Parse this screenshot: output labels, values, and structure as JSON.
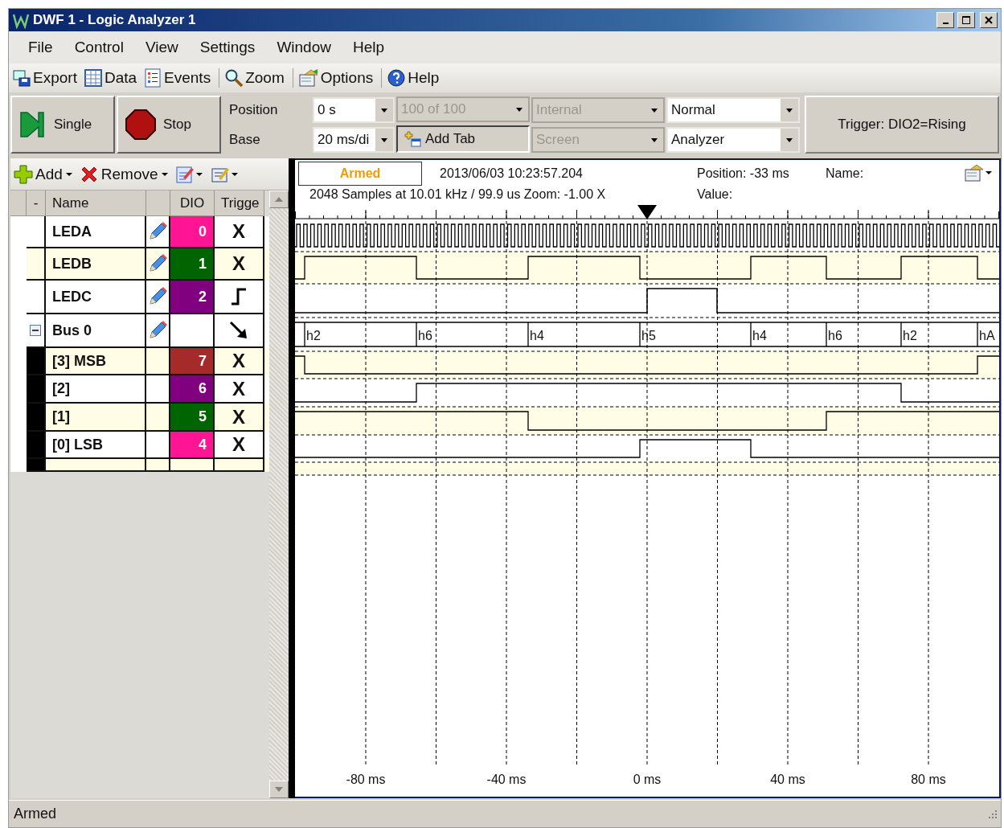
{
  "window": {
    "title": "DWF 1 - Logic Analyzer 1"
  },
  "menu": [
    "File",
    "Control",
    "View",
    "Settings",
    "Window",
    "Help"
  ],
  "toolbar": [
    [
      "Export",
      "Data",
      "Events"
    ],
    [
      "Zoom"
    ],
    [
      "Options"
    ],
    [
      "Help"
    ]
  ],
  "acquisition": {
    "single": "Single",
    "stop": "Stop",
    "position_label": "Position",
    "position_value": "0 s",
    "base_label": "Base",
    "base_value": "20 ms/di",
    "buffer": {
      "value": "100 of 100",
      "disabled": true
    },
    "add_tab": "Add Tab",
    "source": {
      "value": "Internal",
      "disabled": true
    },
    "view": {
      "value": "Screen",
      "disabled": true
    },
    "mode": {
      "value": "Normal",
      "disabled": false
    },
    "type": {
      "value": "Analyzer",
      "disabled": false
    },
    "trigger": "Trigger: DIO2=Rising"
  },
  "channel_toolbar": {
    "add": "Add",
    "remove": "Remove"
  },
  "channels": {
    "columns": [
      "-",
      "Name",
      "DIO",
      "Trigge"
    ],
    "rows": [
      {
        "kind": "signal",
        "name": "LEDA",
        "dio": "0",
        "color": "#ff1493",
        "trigger": {
          "kind": "text",
          "text": "X"
        },
        "shaded": false
      },
      {
        "kind": "signal",
        "name": "LEDB",
        "dio": "1",
        "color": "#006400",
        "trigger": {
          "kind": "text",
          "text": "X"
        },
        "shaded": true
      },
      {
        "kind": "signal",
        "name": "LEDC",
        "dio": "2",
        "color": "#800080",
        "trigger": {
          "kind": "rising"
        },
        "shaded": false
      },
      {
        "kind": "bus",
        "name": "Bus 0",
        "trigger": {
          "kind": "edge"
        },
        "expanded": true,
        "shaded": false,
        "children": [
          {
            "name": "[3] MSB",
            "dio": "7",
            "color": "#a52a2a",
            "trigger": {
              "kind": "text",
              "text": "X"
            },
            "shaded": true
          },
          {
            "name": "[2]",
            "dio": "6",
            "color": "#800080",
            "trigger": {
              "kind": "text",
              "text": "X"
            },
            "shaded": false
          },
          {
            "name": "[1]",
            "dio": "5",
            "color": "#006400",
            "trigger": {
              "kind": "text",
              "text": "X"
            },
            "shaded": true
          },
          {
            "name": "[0] LSB",
            "dio": "4",
            "color": "#ff1493",
            "trigger": {
              "kind": "text",
              "text": "X"
            },
            "shaded": false
          }
        ]
      }
    ]
  },
  "plot": {
    "state": "Armed",
    "timestamp": "2013/06/03  10:23:57.204",
    "samples": "2048 Samples at 10.01 kHz / 99.9 us Zoom: -1.00 X",
    "position": "Position: -33 ms",
    "name": "Name:",
    "value": "Value:",
    "bus_values": [
      "h2",
      "h6",
      "h4",
      "h5",
      "h4",
      "h6",
      "h2",
      "hA"
    ],
    "axis_labels": [
      "-80 ms",
      "-40 ms",
      "0 ms",
      "40 ms",
      "80 ms"
    ]
  },
  "status_bar": "Armed"
}
